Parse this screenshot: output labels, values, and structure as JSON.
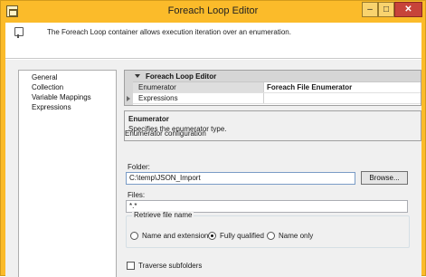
{
  "window": {
    "title": "Foreach Loop Editor",
    "buttons": {
      "minimize": "–",
      "maximize": "□",
      "close": "✕"
    }
  },
  "header": {
    "description": "The Foreach Loop container allows execution iteration over an enumeration."
  },
  "sidebar": {
    "items": [
      {
        "label": "General"
      },
      {
        "label": "Collection"
      },
      {
        "label": "Variable Mappings"
      },
      {
        "label": "Expressions"
      }
    ]
  },
  "property_grid": {
    "category": "Foreach Loop Editor",
    "rows": [
      {
        "name": "Enumerator",
        "value": "Foreach File Enumerator"
      },
      {
        "name": "Expressions",
        "value": ""
      }
    ]
  },
  "description_panel": {
    "title": "Enumerator",
    "text": "Specifies the enumerator type."
  },
  "enumerator_config": {
    "title": "Enumerator configuration",
    "folder_label": "Folder:",
    "folder_value": "C:\\temp\\JSON_Import",
    "browse_label": "Browse...",
    "files_label": "Files:",
    "files_value": "*.*",
    "retrieve_group": {
      "title": "Retrieve file name",
      "options": [
        {
          "label": "Name and extension",
          "checked": false
        },
        {
          "label": "Fully qualified",
          "checked": true
        },
        {
          "label": "Name only",
          "checked": false
        }
      ]
    },
    "traverse_label": "Traverse subfolders",
    "traverse_checked": false
  },
  "colors": {
    "title_bar": "#fbbb2a",
    "close_button": "#c7433a",
    "panel_background": "#f0f0f0",
    "input_focus_border": "#7a9cc6"
  }
}
